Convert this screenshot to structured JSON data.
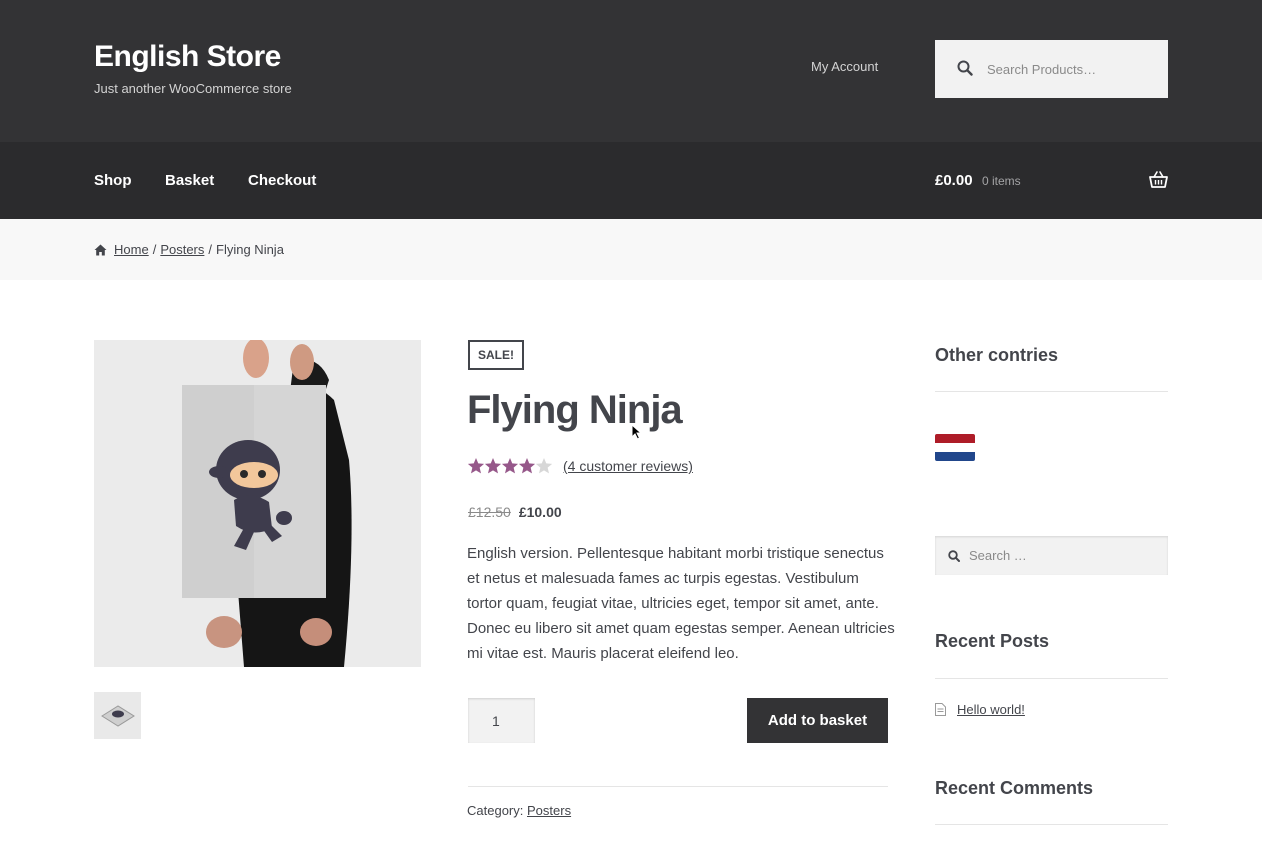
{
  "header": {
    "site_title": "English Store",
    "site_description": "Just another WooCommerce store",
    "my_account": "My Account",
    "search_placeholder": "Search Products…"
  },
  "nav": {
    "items": [
      "Shop",
      "Basket",
      "Checkout"
    ],
    "cart_total": "£0.00",
    "cart_items": "0 items"
  },
  "breadcrumb": {
    "home": "Home",
    "category": "Posters",
    "current": "Flying Ninja",
    "separator": "/"
  },
  "product": {
    "sale_badge": "SALE!",
    "title": "Flying Ninja",
    "rating": 4,
    "rating_max": 5,
    "reviews_link": "(4 customer reviews)",
    "old_price": "£12.50",
    "new_price": "£10.00",
    "description": "English version. Pellentesque habitant morbi tristique senectus et netus et malesuada fames ac turpis egestas. Vestibulum tortor quam, feugiat vitae, ultricies eget, tempor sit amet, ante. Donec eu libero sit amet quam egestas semper. Aenean ultricies mi vitae est. Mauris placerat eleifend leo.",
    "quantity": "1",
    "add_to_basket": "Add to basket",
    "category_label": "Category:",
    "category_value": "Posters"
  },
  "sidebar": {
    "other_countries_title": "Other contries",
    "search_placeholder": "Search …",
    "recent_posts_title": "Recent Posts",
    "recent_posts": [
      "Hello world!"
    ],
    "recent_comments_title": "Recent Comments"
  },
  "colors": {
    "header_bg": "#333335",
    "nav_bg": "#2b2b2d",
    "star_color": "#96588a",
    "button_bg": "#333335",
    "flag_red": "#ae1c28",
    "flag_white": "#ffffff",
    "flag_blue": "#21468b"
  }
}
